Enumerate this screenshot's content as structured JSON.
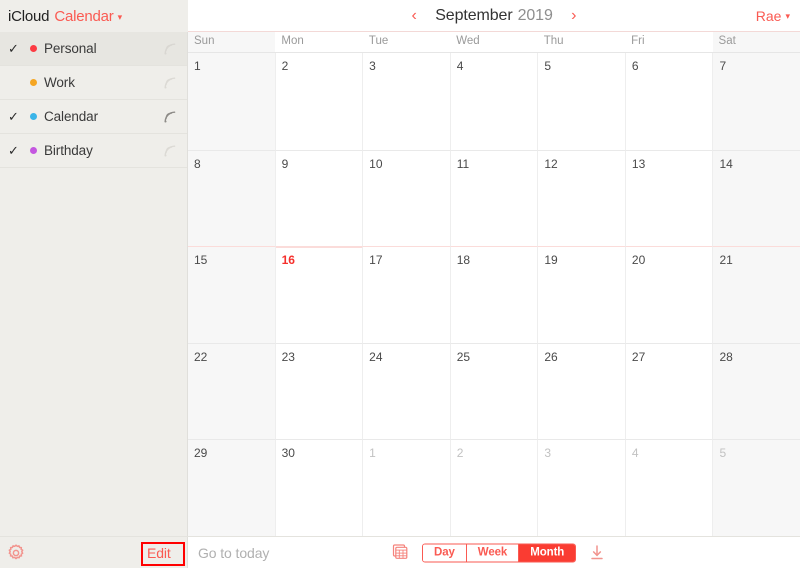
{
  "brand": {
    "suite": "iCloud",
    "app": "Calendar",
    "chevron_icon": "chevron-down-icon"
  },
  "header": {
    "prev_icon": "chevron-left-icon",
    "next_icon": "chevron-right-icon",
    "month": "September",
    "year": "2019",
    "account": "Rae",
    "account_chevron_icon": "chevron-down-icon"
  },
  "sidebar": {
    "calendars": [
      {
        "label": "Personal",
        "color": "#fc3b43",
        "checked": true,
        "check_glyph": "✓",
        "selected": true,
        "share_icon": "broadcast-icon",
        "share_active": false
      },
      {
        "label": "Work",
        "color": "#f5a623",
        "checked": false,
        "check_glyph": "",
        "selected": false,
        "share_icon": "broadcast-icon",
        "share_active": false
      },
      {
        "label": "Calendar",
        "color": "#3ab4e8",
        "checked": true,
        "check_glyph": "✓",
        "selected": false,
        "share_icon": "broadcast-icon",
        "share_active": true
      },
      {
        "label": "Birthday",
        "color": "#c457e0",
        "checked": true,
        "check_glyph": "✓",
        "selected": false,
        "share_icon": "broadcast-icon",
        "share_active": false
      }
    ]
  },
  "calendar": {
    "day_headers": [
      "Sun",
      "Mon",
      "Tue",
      "Wed",
      "Thu",
      "Fri",
      "Sat"
    ],
    "weeks": [
      [
        {
          "n": "1",
          "other": false,
          "today": false
        },
        {
          "n": "2",
          "other": false,
          "today": false
        },
        {
          "n": "3",
          "other": false,
          "today": false
        },
        {
          "n": "4",
          "other": false,
          "today": false
        },
        {
          "n": "5",
          "other": false,
          "today": false
        },
        {
          "n": "6",
          "other": false,
          "today": false
        },
        {
          "n": "7",
          "other": false,
          "today": false
        }
      ],
      [
        {
          "n": "8",
          "other": false,
          "today": false
        },
        {
          "n": "9",
          "other": false,
          "today": false
        },
        {
          "n": "10",
          "other": false,
          "today": false
        },
        {
          "n": "11",
          "other": false,
          "today": false
        },
        {
          "n": "12",
          "other": false,
          "today": false
        },
        {
          "n": "13",
          "other": false,
          "today": false
        },
        {
          "n": "14",
          "other": false,
          "today": false
        }
      ],
      [
        {
          "n": "15",
          "other": false,
          "today": false
        },
        {
          "n": "16",
          "other": false,
          "today": true
        },
        {
          "n": "17",
          "other": false,
          "today": false
        },
        {
          "n": "18",
          "other": false,
          "today": false
        },
        {
          "n": "19",
          "other": false,
          "today": false
        },
        {
          "n": "20",
          "other": false,
          "today": false
        },
        {
          "n": "21",
          "other": false,
          "today": false
        }
      ],
      [
        {
          "n": "22",
          "other": false,
          "today": false
        },
        {
          "n": "23",
          "other": false,
          "today": false
        },
        {
          "n": "24",
          "other": false,
          "today": false
        },
        {
          "n": "25",
          "other": false,
          "today": false
        },
        {
          "n": "26",
          "other": false,
          "today": false
        },
        {
          "n": "27",
          "other": false,
          "today": false
        },
        {
          "n": "28",
          "other": false,
          "today": false
        }
      ],
      [
        {
          "n": "29",
          "other": false,
          "today": false
        },
        {
          "n": "30",
          "other": false,
          "today": false
        },
        {
          "n": "1",
          "other": true,
          "today": false
        },
        {
          "n": "2",
          "other": true,
          "today": false
        },
        {
          "n": "3",
          "other": true,
          "today": false
        },
        {
          "n": "4",
          "other": true,
          "today": false
        },
        {
          "n": "5",
          "other": true,
          "today": false
        }
      ]
    ],
    "today_week_index": 2
  },
  "bottombar": {
    "settings_icon": "gear-icon",
    "edit_label": "Edit",
    "goto_today_label": "Go to today",
    "layers_icon": "stacked-calendars-icon",
    "download_icon": "download-arrow-icon",
    "views": [
      {
        "label": "Day",
        "active": false
      },
      {
        "label": "Week",
        "active": false
      },
      {
        "label": "Month",
        "active": true
      }
    ]
  },
  "annotation": {
    "target": "edit-button",
    "color": "#ff0000"
  },
  "colors": {
    "accent": "#fa5a52",
    "today": "#f5302c",
    "sidebar_bg": "#efeeea",
    "weekend_bg": "#f7f7f7"
  }
}
